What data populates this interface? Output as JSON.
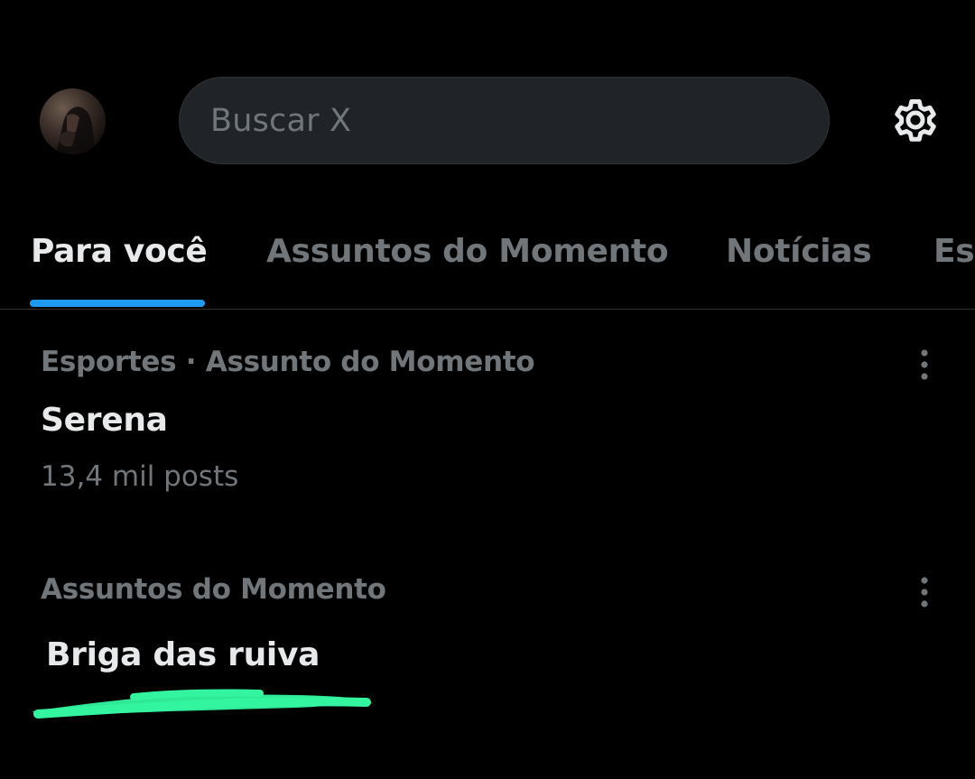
{
  "header": {
    "avatar_alt": "profile-avatar",
    "search_placeholder": "Buscar X",
    "settings_icon": "gear-icon"
  },
  "tabs": [
    {
      "label": "Para você",
      "active": true
    },
    {
      "label": "Assuntos do Momento",
      "active": false
    },
    {
      "label": "Notícias",
      "active": false
    },
    {
      "label": "Esportes",
      "active": false
    }
  ],
  "trends": [
    {
      "meta": "Esportes · Assunto do Momento",
      "title": "Serena",
      "count": "13,4 mil posts"
    },
    {
      "meta": "Assuntos do Momento",
      "title": "Briga das ruiva"
    }
  ],
  "colors": {
    "background": "#000000",
    "accent": "#1d9bf0",
    "primary_text": "#e7e9ea",
    "secondary_text": "#71767b",
    "search_bg": "#202327",
    "highlight_marker": "#33f5a0"
  }
}
